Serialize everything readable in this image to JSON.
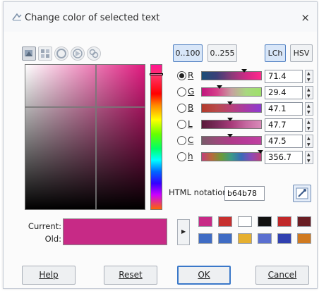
{
  "window": {
    "title": "Change color of selected text",
    "close_glyph": "×"
  },
  "tool_tabs": [
    {
      "name": "color-scale-icon",
      "active": true
    },
    {
      "name": "palette-grid-icon",
      "active": false
    },
    {
      "name": "color-wheel-icon",
      "active": false
    },
    {
      "name": "triangle-wheel-icon",
      "active": false
    },
    {
      "name": "watercolor-icon",
      "active": false
    }
  ],
  "range_buttons": {
    "r100": "0..100",
    "r255": "0..255"
  },
  "model_buttons": {
    "lch": "LCh",
    "hsv": "HSV"
  },
  "channels": [
    {
      "label": "R",
      "value": "71.4",
      "selected": true,
      "level": 0.714,
      "gradient": "linear-gradient(to right, #1a4f78, #3b3f78, #8a3a78, #d02a86, #ff2a8c)"
    },
    {
      "label": "G",
      "value": "29.4",
      "selected": false,
      "level": 0.294,
      "gradient": "linear-gradient(to right, #c0157d, #d63f8a, #c7a0a0, #a8d880, #9fe06a)"
    },
    {
      "label": "B",
      "value": "47.1",
      "selected": false,
      "level": 0.471,
      "gradient": "linear-gradient(to right, #b43a2a, #b84a4a, #b8407a, #a63aa8, #8d3ad0)"
    },
    {
      "label": "L",
      "value": "47.7",
      "selected": false,
      "level": 0.477,
      "gradient": "linear-gradient(to right, #5a1a3a, #7a2a5a, #a83a7a, #c668a0, #d88ab8)"
    },
    {
      "label": "C",
      "value": "47.5",
      "selected": false,
      "level": 0.475,
      "gradient": "linear-gradient(to right, #7a5a6a, #9a4a7a, #b03a8a, #b83a9a, #c040a0)"
    },
    {
      "label": "h",
      "value": "356.7",
      "selected": false,
      "level": 0.991,
      "gradient": "linear-gradient(to right, #c0407a, #b86a3a, #6a9a3a, #3a9a8a, #3a6ab8, #8a4ab8, #c0407a)"
    }
  ],
  "html_notation": {
    "label": "HTML notation:",
    "value": "b64b78"
  },
  "current": {
    "label": "Current:",
    "old_label": "Old:",
    "color": "#c72a86"
  },
  "main_color": "#e01a7f",
  "hue_level": 0.06,
  "palette": [
    "#c72a86",
    "#c7302f",
    "#ffffff",
    "#111111",
    "#c0282a",
    "#6a1e24",
    "#3f6cc4",
    "#3f6cc4",
    "#e6b030",
    "#5a6fd0",
    "#3040b0",
    "#d07a20"
  ],
  "buttons": {
    "help": "Help",
    "reset": "Reset",
    "ok": "OK",
    "cancel": "Cancel"
  }
}
